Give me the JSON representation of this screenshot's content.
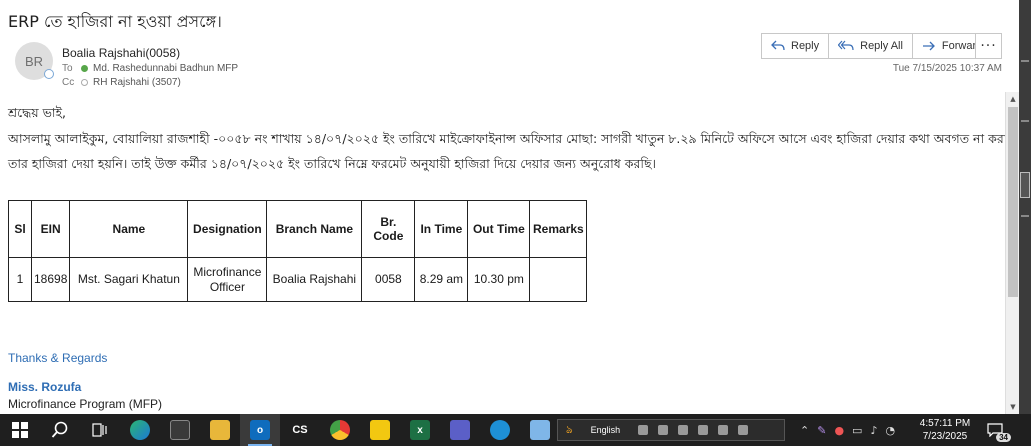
{
  "email": {
    "subject": "ERP তে হাজিরা না হওয়া প্রসঙ্গে।",
    "avatar_initials": "BR",
    "sender": "Boalia Rajshahi(0058)",
    "to_label": "To",
    "to_name": "Md. Rashedunnabi Badhun MFP",
    "cc_label": "Cc",
    "cc_name": "RH Rajshahi (3507)",
    "datetime": "Tue 7/15/2025 10:37 AM"
  },
  "actions": {
    "reply": "Reply",
    "reply_all": "Reply All",
    "forward": "Forward",
    "more": "···"
  },
  "body": {
    "greeting": "শ্রদ্ধেয় ভাই,",
    "line1": "আসলামু আলাইকুম, বোয়ালিয়া রাজশাহী -০০৫৮ নং শাখায় ১৪/০৭/২০২৫ ইং তারিখে মাইক্রোফাইনান্স অফিসার মোছা: সাগরী খাতুন ৮.২৯ মিনিটে অফিসে আসে এবং হাজিরা দেয়ার কথা অবগত না করায় ভুলবসত",
    "line2": "তার হাজিরা দেয়া হয়নি। তাই উক্ত কর্মীর ১৪/০৭/২০২৫  ইং তারিখে নিম্নে ফরমেট অনুযায়ী হাজিরা দিয়ে দেয়ার জন্য অনুরোধ করছি।"
  },
  "table": {
    "headers": [
      "Sl",
      "EIN",
      "Name",
      "Designation",
      "Branch Name",
      "Br. Code",
      "In Time",
      "Out Time",
      "Remarks"
    ],
    "row": {
      "sl": "1",
      "ein": "18698",
      "name": "Mst. Sagari Khatun",
      "designation_1": "Microfinance",
      "designation_2": "Officer",
      "branch": "Boalia Rajshahi",
      "code": "0058",
      "in_time": "8.29 am",
      "out_time": "10.30 pm",
      "remarks": ""
    }
  },
  "signature": {
    "thanks": "Thanks & Regards",
    "name": "Miss. Rozufa",
    "org": "Microfinance Program (MFP)"
  },
  "taskbar": {
    "language": "English",
    "time": "4:57:11 PM",
    "date": "7/23/2025",
    "notification_count": "34",
    "cs_label": "CS"
  },
  "colors": {
    "accent": "#2e6db4",
    "taskbar": "#1f1f1f",
    "presence_green": "#57a64a"
  }
}
